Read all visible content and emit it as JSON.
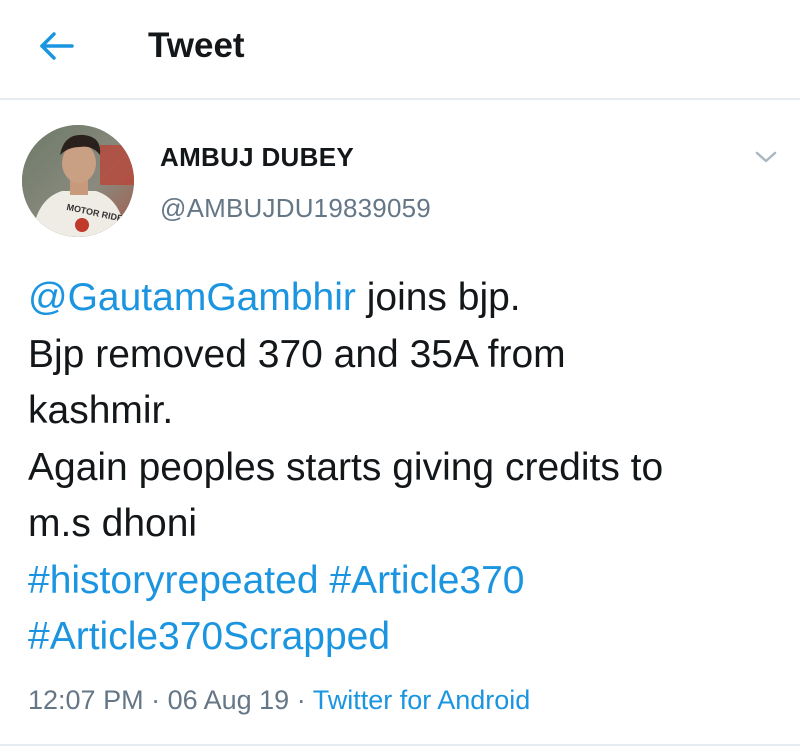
{
  "header": {
    "title": "Tweet",
    "back_icon": "arrow-left-icon"
  },
  "author": {
    "display_name": "AMBUJ DUBEY",
    "handle": "@AMBUJDU19839059",
    "avatar_shirt_text": "MOTOR RIDERS"
  },
  "tweet": {
    "mention": "@GautamGambhir",
    "line1_rest": " joins bjp.",
    "line2": "Bjp removed 370 and 35A from",
    "line3": "kashmir.",
    "line4": "Again peoples starts giving credits to",
    "line5": "m.s dhoni",
    "hashtag1": "#historyrepeated",
    "hashtag2": "#Article370",
    "hashtag3": "#Article370Scrapped"
  },
  "meta": {
    "time": "12:07 PM",
    "separator": " · ",
    "date": "06 Aug 19",
    "source": "Twitter for Android"
  },
  "colors": {
    "accent": "#1b95e0",
    "muted": "#657786",
    "text": "#14171a",
    "divider": "#e6ecf0"
  }
}
